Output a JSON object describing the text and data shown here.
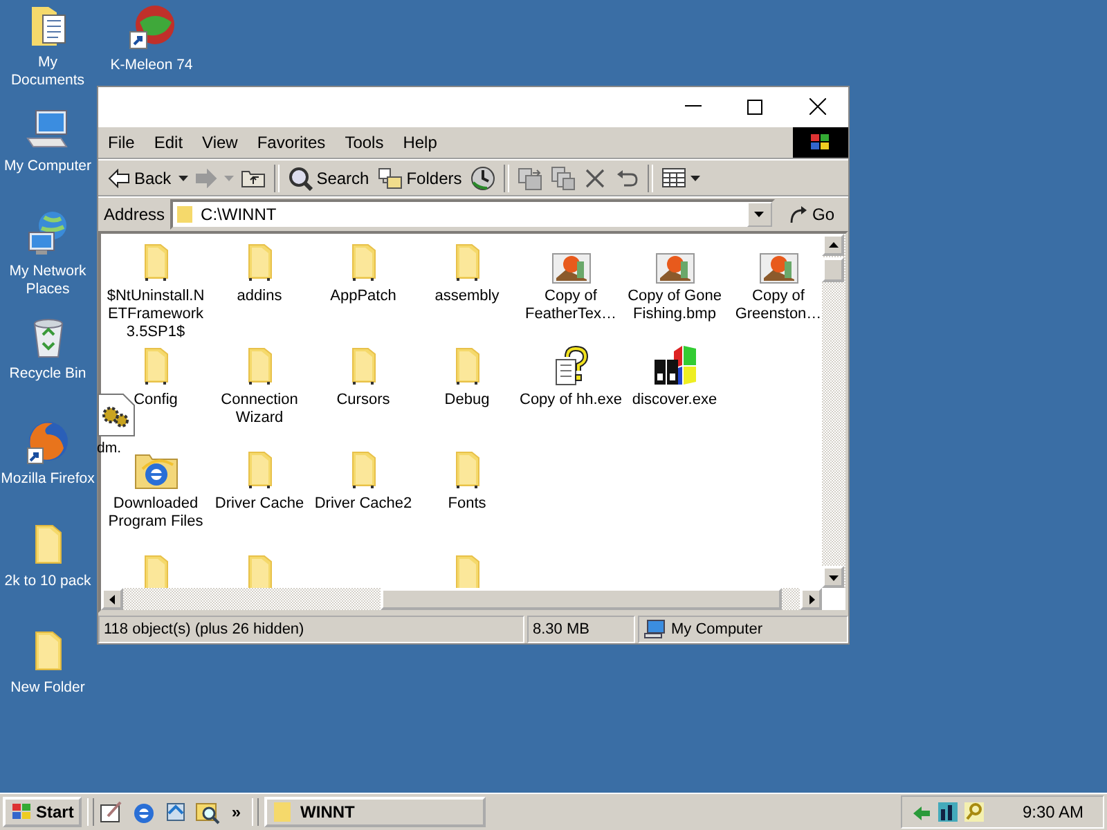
{
  "desktop_icons": [
    {
      "label": "My Documents",
      "kind": "documents"
    },
    {
      "label": "K-Meleon 74",
      "kind": "meleon"
    },
    {
      "label": "My Computer",
      "kind": "computer"
    },
    {
      "label": "My Network Places",
      "kind": "network"
    },
    {
      "label": "Recycle Bin",
      "kind": "recycle"
    },
    {
      "label": "Mozilla Firefox",
      "kind": "firefox"
    },
    {
      "label": "2k to 10 pack",
      "kind": "folder"
    },
    {
      "label": "New Folder",
      "kind": "folder"
    }
  ],
  "floating_icon": {
    "label": "dm.",
    "kind": "settings-file"
  },
  "window": {
    "menu": [
      "File",
      "Edit",
      "View",
      "Favorites",
      "Tools",
      "Help"
    ],
    "toolbar": [
      {
        "kind": "back",
        "label": "Back",
        "disabled": false
      },
      {
        "kind": "forward",
        "disabled": true
      },
      {
        "kind": "up"
      },
      {
        "kind": "sep"
      },
      {
        "kind": "search",
        "label": "Search"
      },
      {
        "kind": "folders",
        "label": "Folders"
      },
      {
        "kind": "history"
      },
      {
        "kind": "sep"
      },
      {
        "kind": "move"
      },
      {
        "kind": "copy"
      },
      {
        "kind": "delete"
      },
      {
        "kind": "undo"
      },
      {
        "kind": "sep"
      },
      {
        "kind": "views"
      }
    ],
    "address": {
      "label": "Address",
      "value": "C:\\WINNT",
      "go": "Go"
    },
    "files": [
      [
        {
          "label": "$NtUninstall.NETFramework3.5SP1$",
          "kind": "folder"
        },
        {
          "label": "addins",
          "kind": "folder"
        },
        {
          "label": "AppPatch",
          "kind": "folder"
        },
        {
          "label": "assembly",
          "kind": "folder"
        },
        {
          "label": "Copy of FeatherTex…",
          "kind": "image"
        },
        {
          "label": "Copy of Gone Fishing.bmp",
          "kind": "image"
        },
        {
          "label": "Copy of Greenston…",
          "kind": "image"
        }
      ],
      [
        {
          "label": "Config",
          "kind": "folder"
        },
        {
          "label": "Connection Wizard",
          "kind": "folder"
        },
        {
          "label": "Cursors",
          "kind": "folder"
        },
        {
          "label": "Debug",
          "kind": "folder"
        },
        {
          "label": "Copy of hh.exe",
          "kind": "help"
        },
        {
          "label": "discover.exe",
          "kind": "discover"
        }
      ],
      [
        {
          "label": "Downloaded Program Files",
          "kind": "ie-folder"
        },
        {
          "label": "Driver Cache",
          "kind": "folder"
        },
        {
          "label": "Driver Cache2",
          "kind": "folder"
        },
        {
          "label": "Fonts",
          "kind": "folder"
        }
      ],
      [
        {
          "kind": "folder"
        },
        {
          "kind": "folder"
        },
        {
          "kind": "gap"
        },
        {
          "kind": "folder"
        }
      ]
    ],
    "status_bar": {
      "objects": "118 object(s) (plus 26 hidden)",
      "size": "8.30 MB",
      "zone": "My Computer"
    }
  },
  "taskbar": {
    "start": "Start",
    "quick_launch": [
      {
        "kind": "desktop"
      },
      {
        "kind": "ie"
      },
      {
        "kind": "outlook"
      },
      {
        "kind": "explorer"
      }
    ],
    "more": "»",
    "tasks": [
      {
        "label": "WINNT",
        "selected": false
      }
    ],
    "clock": "9:30 AM"
  }
}
